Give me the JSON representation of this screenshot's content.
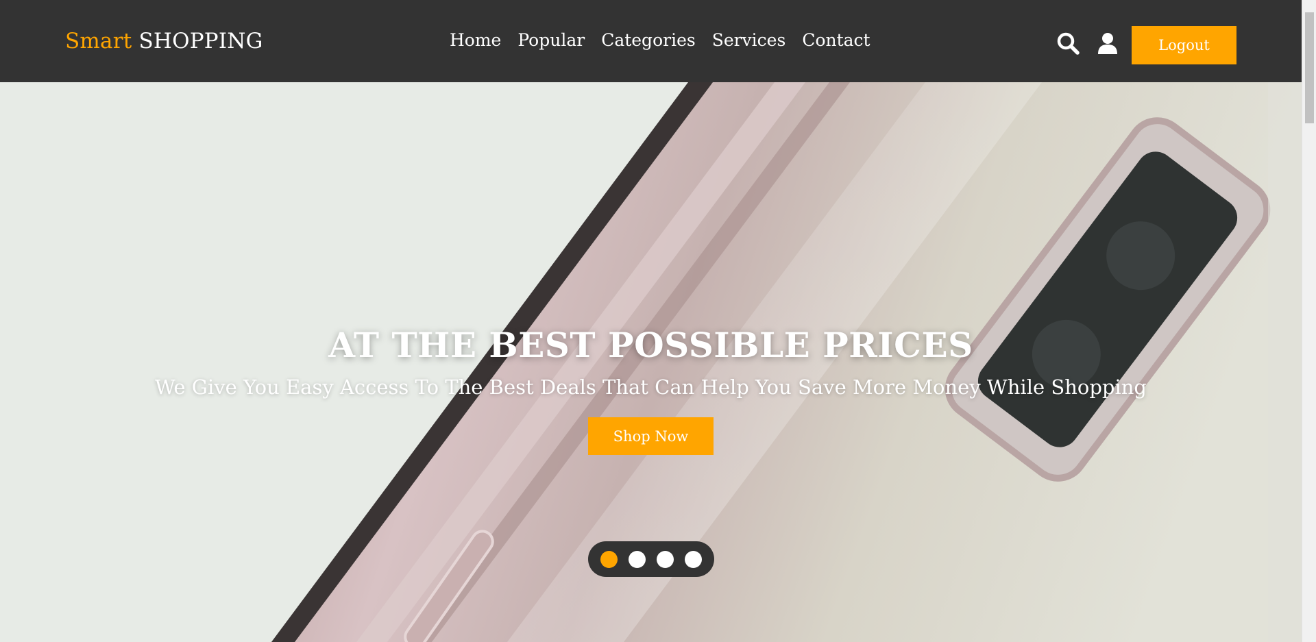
{
  "brand": {
    "accent_word": "Smart",
    "rest": " SHOPPING"
  },
  "nav": [
    "Home",
    "Popular",
    "Categories",
    "Services",
    "Contact"
  ],
  "header_icons": [
    "search-icon",
    "user-icon"
  ],
  "logout_label": "Logout",
  "hero": {
    "title": "AT THE BEST POSSIBLE PRICES",
    "subtitle": "We Give You Easy Access To The Best Deals That Can Help You Save More Money While Shopping",
    "cta": "Shop Now",
    "slides": 4,
    "active_slide": 1
  },
  "colors": {
    "accent": "#FFA500",
    "header_bg": "#333333",
    "hero_bg": "#e7ebe6"
  }
}
